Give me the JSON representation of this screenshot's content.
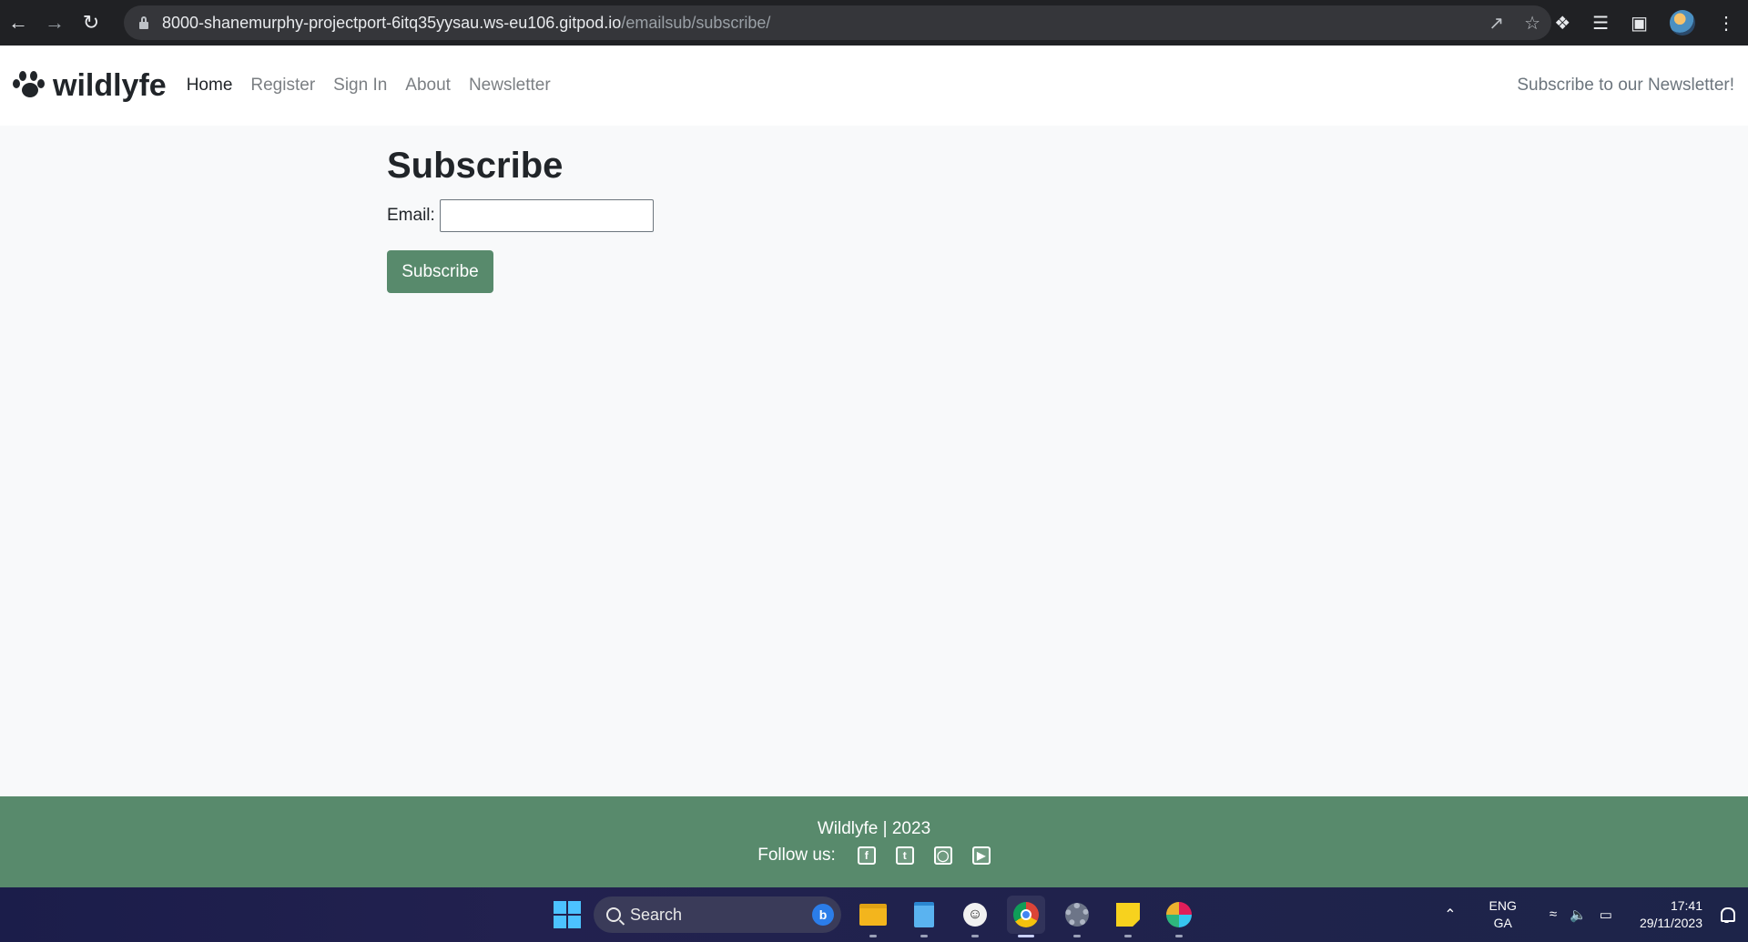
{
  "browser": {
    "back_icon": "arrow-left-icon",
    "forward_icon": "arrow-right-icon",
    "reload_icon": "reload-icon",
    "url_host": "8000-shanemurphy-projectport-6itq35yysau.ws-eu106.gitpod.io",
    "url_path": "/emailsub/subscribe/",
    "omnibox_icons": [
      "share-icon",
      "star-icon"
    ],
    "toolbar_icons": [
      "extensions-icon",
      "media-icon",
      "sidepanel-icon",
      "profile-avatar",
      "menu-icon"
    ]
  },
  "site": {
    "brand": "wildlyfe",
    "nav": [
      {
        "label": "Home",
        "active": true
      },
      {
        "label": "Register",
        "active": false
      },
      {
        "label": "Sign In",
        "active": false
      },
      {
        "label": "About",
        "active": false
      },
      {
        "label": "Newsletter",
        "active": false
      }
    ],
    "nav_right": "Subscribe to our Newsletter!",
    "accent_color": "#588a6c"
  },
  "main": {
    "title": "Subscribe",
    "email_label": "Email:",
    "email_value": "",
    "submit_label": "Subscribe"
  },
  "footer": {
    "line1": "Wildlyfe | 2023",
    "follow_label": "Follow us:",
    "social_icons": [
      "facebook-icon",
      "twitter-icon",
      "instagram-icon",
      "youtube-icon"
    ]
  },
  "taskbar": {
    "search_label": "Search",
    "apps": [
      "file-explorer-icon",
      "notepad-icon",
      "face-app-icon",
      "chrome-icon",
      "settings-icon",
      "sticky-notes-icon",
      "slack-icon"
    ],
    "lang_line1": "ENG",
    "lang_line2": "GA",
    "time": "17:41",
    "date": "29/11/2023"
  }
}
